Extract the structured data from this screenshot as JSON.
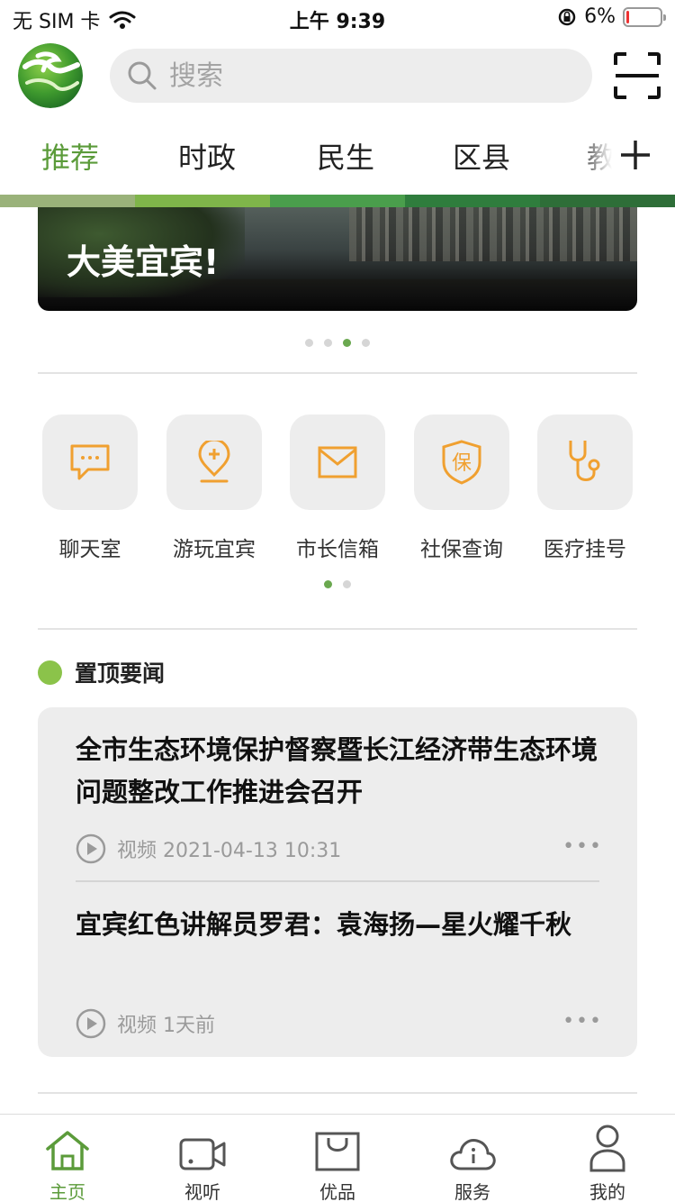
{
  "status_bar": {
    "carrier": "无 SIM 卡",
    "time": "上午 9:39",
    "battery": "6%"
  },
  "header": {
    "search_placeholder": "搜索"
  },
  "tabs": [
    "推荐",
    "时政",
    "民生",
    "区县",
    "教"
  ],
  "active_tab": 0,
  "colors": {
    "brand_green": "#5b9b3a",
    "accent_orange": "#f0a030",
    "stripe": [
      "#9ab27a",
      "#7fb54a",
      "#4a9e4c",
      "#2f7d3d",
      "#2e6e38"
    ]
  },
  "banner": {
    "caption": "大美宜宾!",
    "dots": 4,
    "active_dot": 2
  },
  "services": [
    {
      "label": "聊天室",
      "icon": "chat-icon"
    },
    {
      "label": "游玩宜宾",
      "icon": "location-icon"
    },
    {
      "label": "市长信箱",
      "icon": "mail-icon"
    },
    {
      "label": "社保查询",
      "icon": "social-security-icon"
    },
    {
      "label": "医疗挂号",
      "icon": "stethoscope-icon"
    }
  ],
  "services_pages": 2,
  "services_active_page": 0,
  "pinned": {
    "title": "置顶要闻",
    "items": [
      {
        "title": "全市生态环境保护督察暨长江经济带生态环境问题整改工作推进会召开",
        "meta": "视频 2021-04-13 10:31",
        "more": "•••"
      },
      {
        "title": "宜宾红色讲解员罗君：袁海扬—星火耀千秋",
        "meta": "视频 1天前",
        "more": "•••"
      }
    ]
  },
  "tabbar": [
    {
      "label": "主页",
      "icon": "home-icon"
    },
    {
      "label": "视听",
      "icon": "video-camera-icon"
    },
    {
      "label": "优品",
      "icon": "shopping-bag-icon"
    },
    {
      "label": "服务",
      "icon": "cloud-info-icon"
    },
    {
      "label": "我的",
      "icon": "user-icon"
    }
  ],
  "tabbar_active": 0
}
